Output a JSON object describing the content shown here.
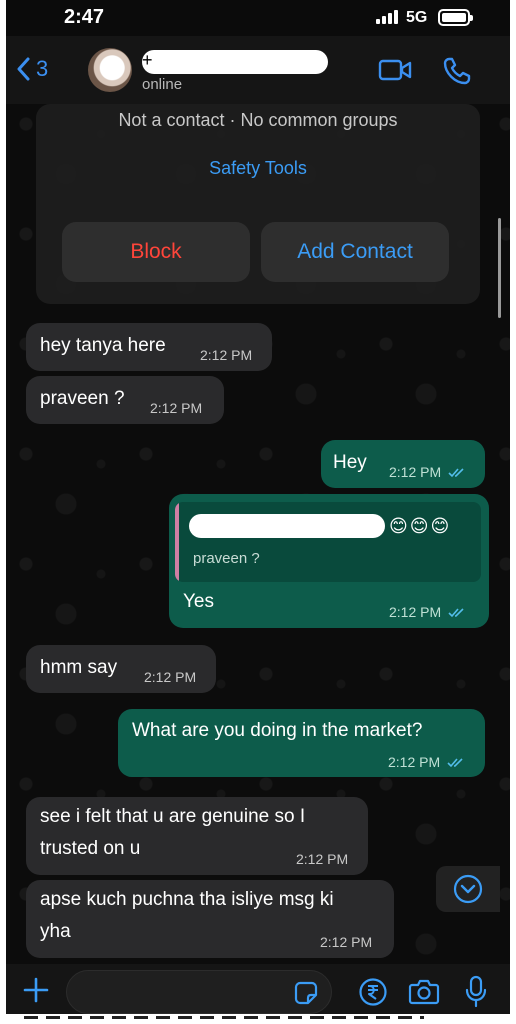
{
  "status_bar": {
    "time": "2:47",
    "network": "5G"
  },
  "header": {
    "back_count": "3",
    "contact_name": "+",
    "contact_status": "online"
  },
  "contact_card": {
    "notice": "Not a contact · No common groups",
    "safety_tools": "Safety Tools",
    "block_label": "Block",
    "add_contact_label": "Add Contact"
  },
  "messages": [
    {
      "direction": "in",
      "text": "hey tanya here",
      "time": "2:12 PM"
    },
    {
      "direction": "in",
      "text": "praveen ?",
      "time": "2:12 PM"
    },
    {
      "direction": "out",
      "text": "Hey",
      "time": "2:12 PM",
      "read": true
    },
    {
      "direction": "out",
      "text": "Yes",
      "time": "2:12 PM",
      "read": true,
      "quoted": {
        "emojis": "😊😊😊",
        "text": "praveen ?"
      }
    },
    {
      "direction": "in",
      "text": "hmm say",
      "time": "2:12 PM"
    },
    {
      "direction": "out",
      "text": "What are you doing in the market?",
      "time": "2:12 PM",
      "read": true
    },
    {
      "direction": "in",
      "text_line1": "see i felt that u are genuine so I",
      "text_line2": "trusted on u",
      "time": "2:12 PM"
    },
    {
      "direction": "in",
      "text_line1": "apse kuch puchna tha isliye msg ki",
      "text_line2": "yha",
      "time": "2:12 PM"
    }
  ],
  "input": {
    "placeholder": ""
  },
  "icons": {
    "back": "chevron-left-icon",
    "video": "video-camera-icon",
    "call": "phone-icon",
    "scroll_down": "chevron-down-circle-icon",
    "attach": "plus-icon",
    "sticker": "sticker-icon",
    "payment": "rupee-icon",
    "camera": "camera-icon",
    "mic": "microphone-icon"
  },
  "colors": {
    "accent": "#3b9cf5",
    "block": "#ff453a",
    "outgoing_bubble": "#0d5c4b",
    "incoming_bubble": "#2a2a2c",
    "read_tick": "#53bdeb"
  }
}
